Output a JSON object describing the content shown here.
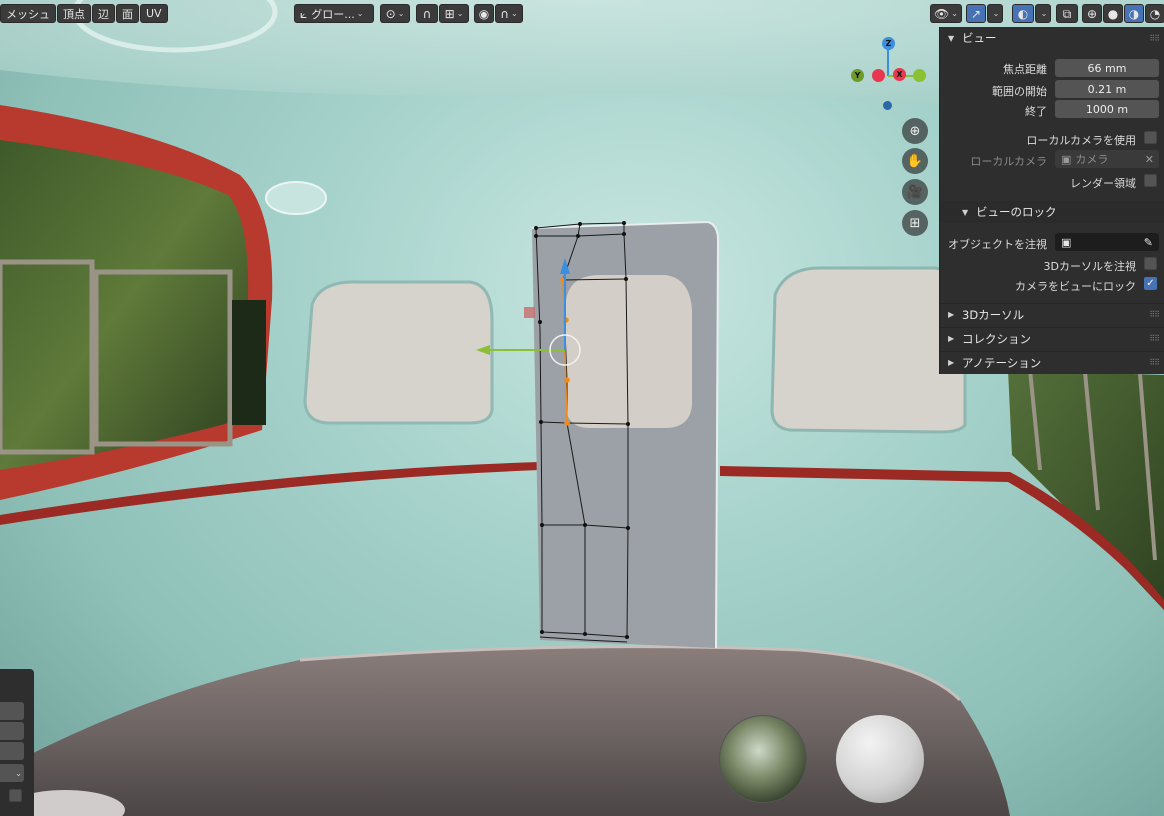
{
  "header": {
    "mode_menus": [
      {
        "label": "メッシュ",
        "name": "menu-mesh"
      },
      {
        "label": "頂点",
        "name": "menu-vertex"
      },
      {
        "label": "辺",
        "name": "menu-edge"
      },
      {
        "label": "面",
        "name": "menu-face"
      },
      {
        "label": "UV",
        "name": "menu-uv"
      }
    ],
    "transform_orientation": "グロー...",
    "pivot_icon": "pivot-icon",
    "snap_icon": "magnet-icon",
    "proportional_icon": "proportional-edit-icon",
    "right_tools": [
      "visibility-eye-icon",
      "gizmo-icon",
      "overlay-icon",
      "xray-icon",
      "wireframe-shading-icon",
      "solid-shading-icon",
      "material-shading-icon",
      "rendered-shading-icon"
    ]
  },
  "gizmo": {
    "z_label": "Z",
    "y_label": "Y",
    "x_label": "X",
    "nav_buttons": [
      "zoom-icon",
      "pan-hand-icon",
      "camera-icon",
      "ortho-grid-icon"
    ]
  },
  "sidebar": {
    "view_panel": {
      "title": "ビュー",
      "focal_length_label": "焦点距離",
      "focal_length_value": "66 mm",
      "clip_start_label": "範囲の開始",
      "clip_start_value": "0.21 m",
      "clip_end_label": "終了",
      "clip_end_value": "1000 m",
      "use_local_camera_label": "ローカルカメラを使用",
      "local_camera_label": "ローカルカメラ",
      "local_camera_value": "カメラ",
      "render_region_label": "レンダー領域"
    },
    "view_lock_panel": {
      "title": "ビューのロック",
      "lock_object_label": "オブジェクトを注視",
      "lock_cursor_label": "3Dカーソルを注視",
      "lock_camera_label": "カメラをビューにロック",
      "lock_camera_checked": true
    },
    "collapsed_panels": [
      {
        "title": "3Dカーソル",
        "name": "panel-3d-cursor"
      },
      {
        "title": "コレクション",
        "name": "panel-collection"
      },
      {
        "title": "アノテーション",
        "name": "panel-annotation"
      }
    ]
  },
  "colors": {
    "accent": "#4772b3",
    "axis_x": "#e8374e",
    "axis_y": "#8bc034",
    "axis_z": "#3b8fe0",
    "interior": "#a5d2cb",
    "stripe": "#9a2a23"
  }
}
